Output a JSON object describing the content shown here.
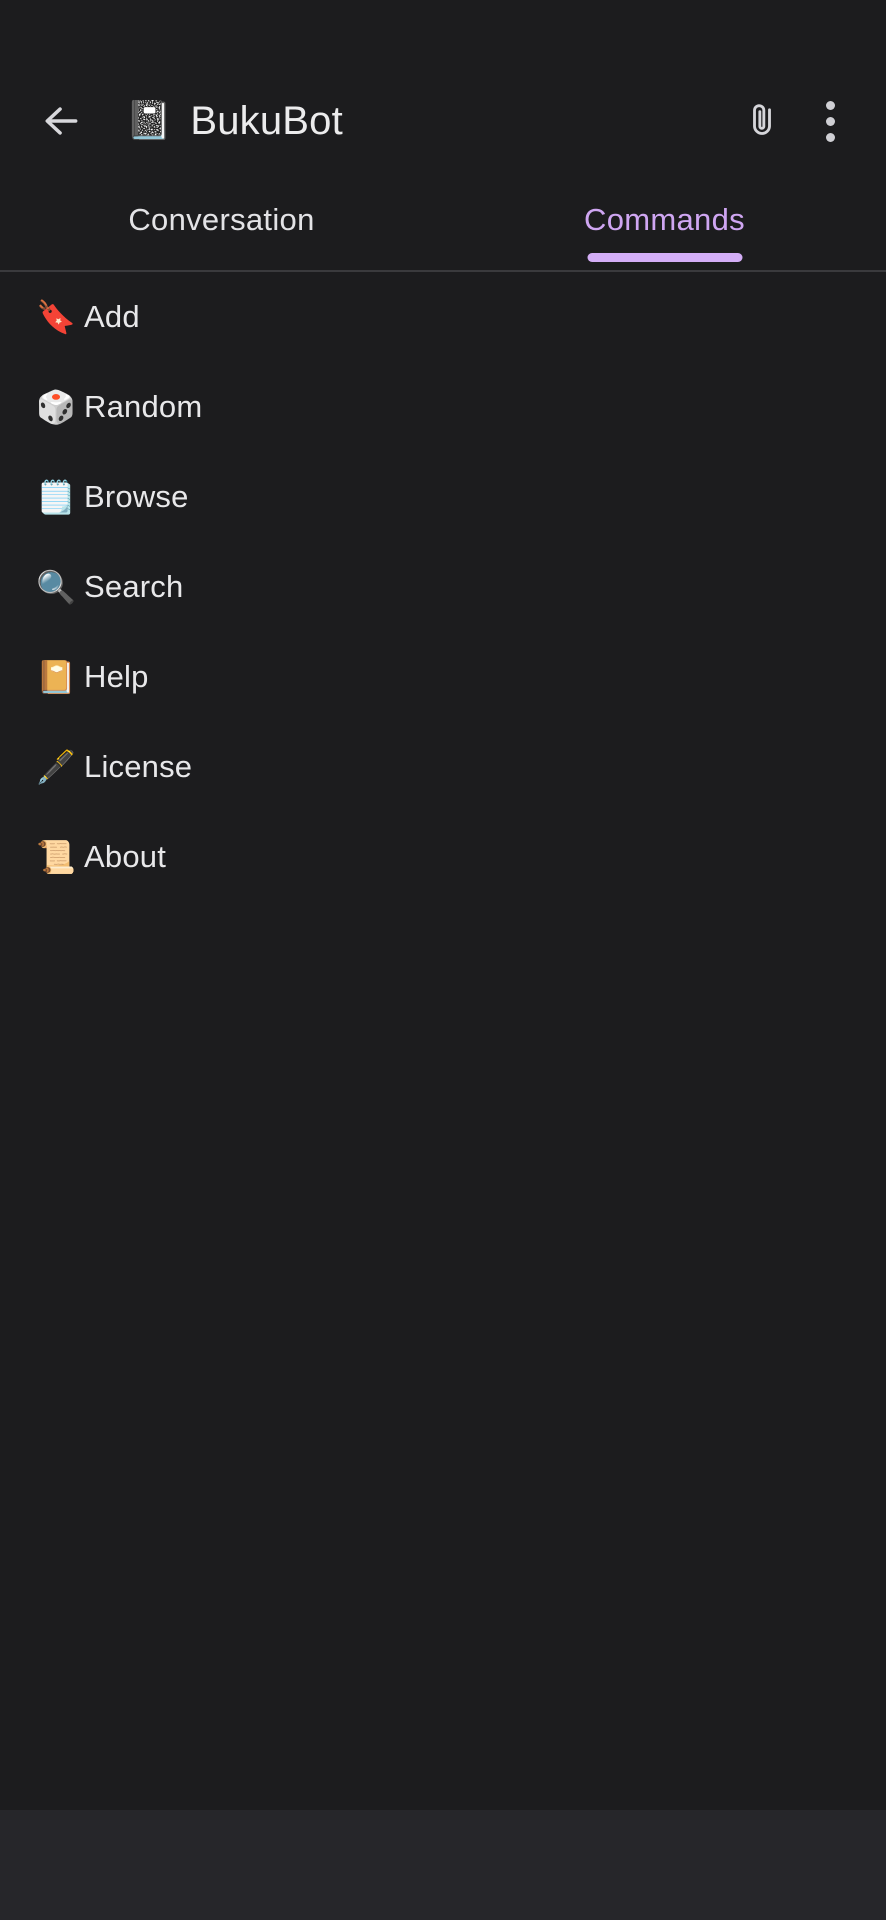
{
  "window": {
    "background_color": "#1c1c1e",
    "system_nav_color": "#26262a"
  },
  "header": {
    "back_icon": "arrow-left-icon",
    "avatar_emoji": "📓",
    "avatar_name": "notebook-emoji",
    "title": "BukuBot",
    "attach_icon": "paperclip-icon",
    "overflow_icon": "more-vertical-icon"
  },
  "tabs": {
    "active_index": 1,
    "active_color": "#cfa6f2",
    "inactive_color": "#e3e3e6",
    "indicator_color": "#d4aef7",
    "items": [
      {
        "label": "Conversation",
        "name": "tab-conversation"
      },
      {
        "label": "Commands",
        "name": "tab-commands"
      }
    ]
  },
  "commands": {
    "items": [
      {
        "emoji": "🔖",
        "emoji_name": "bookmark-icon",
        "label": "Add"
      },
      {
        "emoji": "🎲",
        "emoji_name": "game-die-icon",
        "label": "Random"
      },
      {
        "emoji": "🗒️",
        "emoji_name": "spiral-notepad-icon",
        "label": "Browse"
      },
      {
        "emoji": "🔍",
        "emoji_name": "magnifying-glass-icon",
        "label": "Search"
      },
      {
        "emoji": "📔",
        "emoji_name": "notebook-decorative-cover-icon",
        "label": "Help"
      },
      {
        "emoji": "🖋️",
        "emoji_name": "fountain-pen-icon",
        "label": "License"
      },
      {
        "emoji": "📜",
        "emoji_name": "scroll-icon",
        "label": "About"
      }
    ]
  }
}
